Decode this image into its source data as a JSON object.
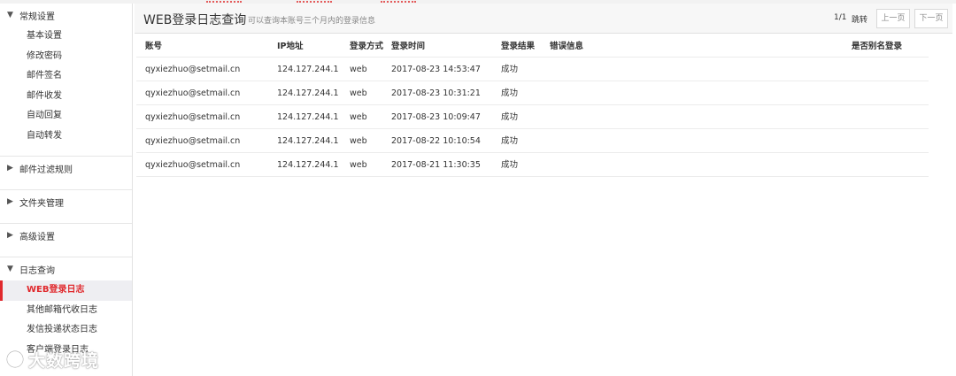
{
  "sidebar": {
    "groups": [
      {
        "label": "常规设置",
        "expanded": true,
        "items": [
          {
            "label": "基本设置"
          },
          {
            "label": "修改密码"
          },
          {
            "label": "邮件签名"
          },
          {
            "label": "邮件收发"
          },
          {
            "label": "自动回复"
          },
          {
            "label": "自动转发"
          }
        ]
      },
      {
        "label": "邮件过滤规则",
        "expanded": false
      },
      {
        "label": "文件夹管理",
        "expanded": false
      },
      {
        "label": "高级设置",
        "expanded": false
      },
      {
        "label": "日志查询",
        "expanded": true,
        "items": [
          {
            "label": "WEB登录日志",
            "active": true
          },
          {
            "label": "其他邮箱代收日志"
          },
          {
            "label": "发信投递状态日志"
          },
          {
            "label": "客户端登录日志"
          }
        ]
      }
    ],
    "accent_color": "#e0292d"
  },
  "header": {
    "title": "WEB登录日志查询",
    "subtitle": "可以查询本账号三个月内的登录信息"
  },
  "pager": {
    "count": "1/1",
    "jump": "跳转",
    "prev": "上一页",
    "next": "下一页"
  },
  "table": {
    "columns": [
      "账号",
      "IP地址",
      "登录方式",
      "登录时间",
      "登录结果",
      "错误信息",
      "是否别名登录"
    ],
    "rows": [
      [
        "qyxiezhuo@setmail.cn",
        "124.127.244.1",
        "web",
        "2017-08-23 14:53:47",
        "成功",
        "",
        ""
      ],
      [
        "qyxiezhuo@setmail.cn",
        "124.127.244.1",
        "web",
        "2017-08-23 10:31:21",
        "成功",
        "",
        ""
      ],
      [
        "qyxiezhuo@setmail.cn",
        "124.127.244.1",
        "web",
        "2017-08-23 10:09:47",
        "成功",
        "",
        ""
      ],
      [
        "qyxiezhuo@setmail.cn",
        "124.127.244.1",
        "web",
        "2017-08-22 10:10:54",
        "成功",
        "",
        ""
      ],
      [
        "qyxiezhuo@setmail.cn",
        "124.127.244.1",
        "web",
        "2017-08-21 11:30:35",
        "成功",
        "",
        ""
      ]
    ]
  },
  "watermark": {
    "text": "大数跨境",
    "icon": "watermark-logo-icon"
  }
}
